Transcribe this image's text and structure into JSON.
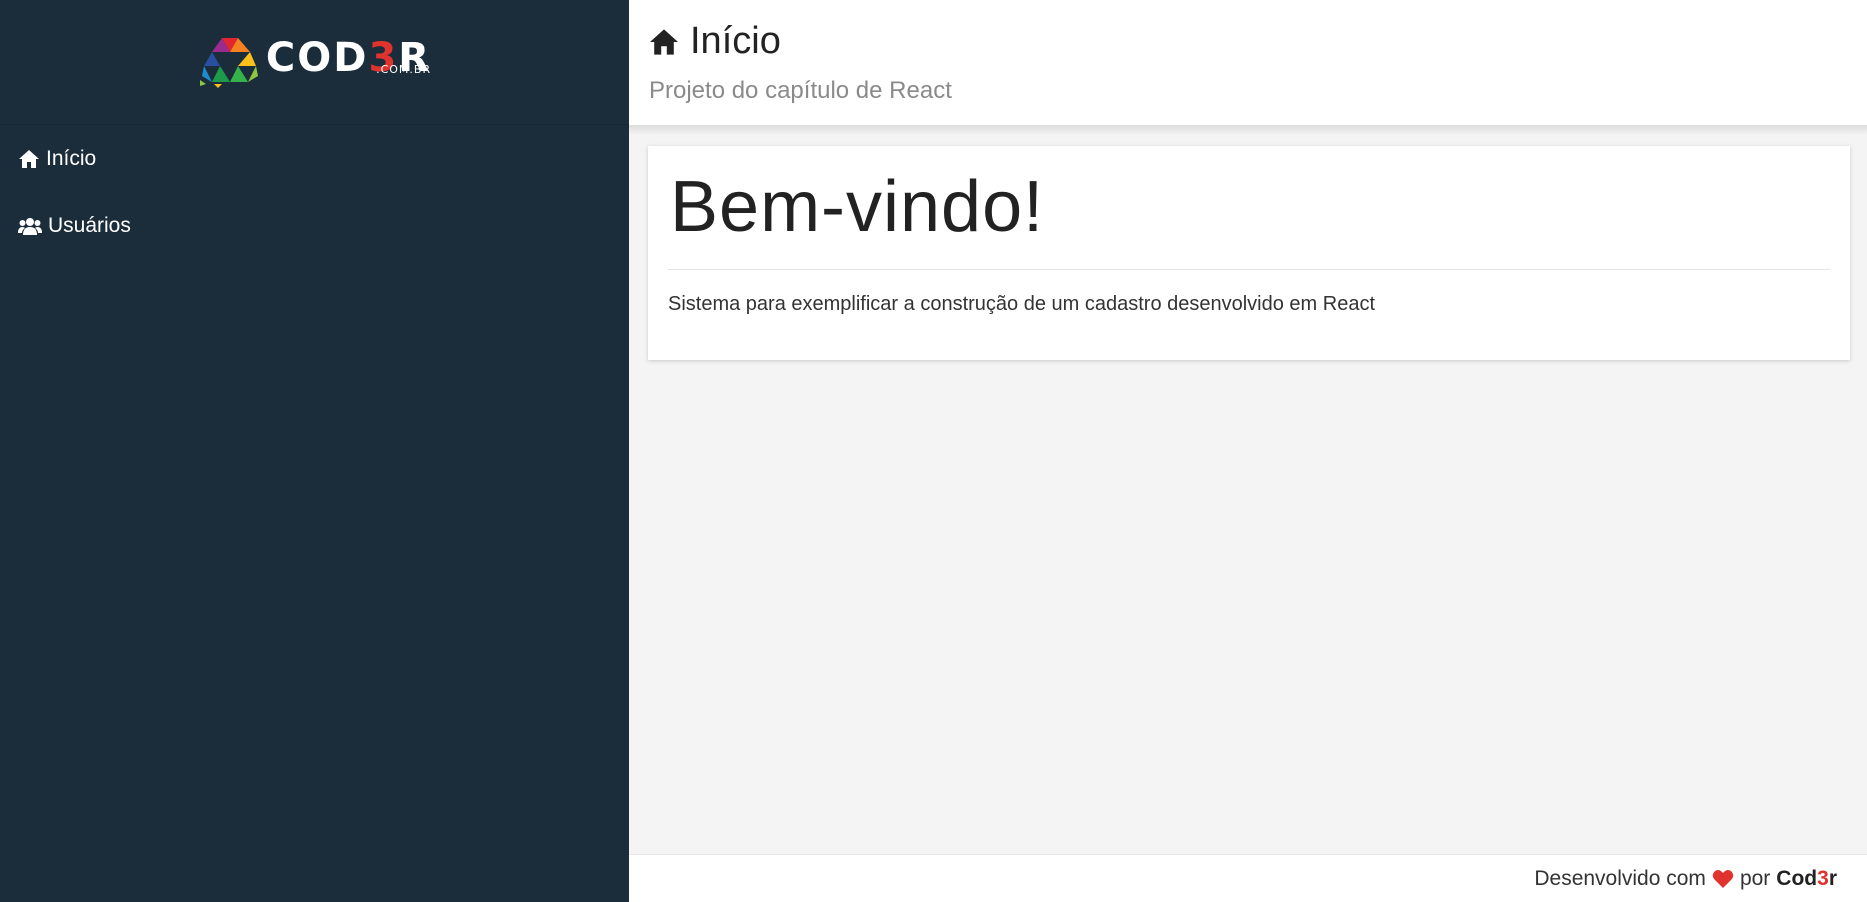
{
  "sidebar": {
    "logo": {
      "text_main": "COD",
      "text_accent": "3",
      "text_end": "R",
      "subtext": ".COM.BR"
    },
    "items": [
      {
        "label": "Início",
        "icon": "home-icon"
      },
      {
        "label": "Usuários",
        "icon": "users-icon"
      }
    ]
  },
  "header": {
    "title": "Início",
    "title_icon": "home-icon",
    "subtitle": "Projeto do capítulo de React"
  },
  "main": {
    "heading": "Bem-vindo!",
    "text": "Sistema para exemplificar a construção de um cadastro desenvolvido em React"
  },
  "footer": {
    "prefix": "Desenvolvido com",
    "heart_icon": "heart-icon",
    "middle": "por",
    "brand_main": "Cod",
    "brand_accent": "3",
    "brand_end": "r"
  },
  "colors": {
    "sidebar_bg": "#1b2d3b",
    "accent_red": "#e0332e",
    "content_bg": "#f4f4f4"
  }
}
